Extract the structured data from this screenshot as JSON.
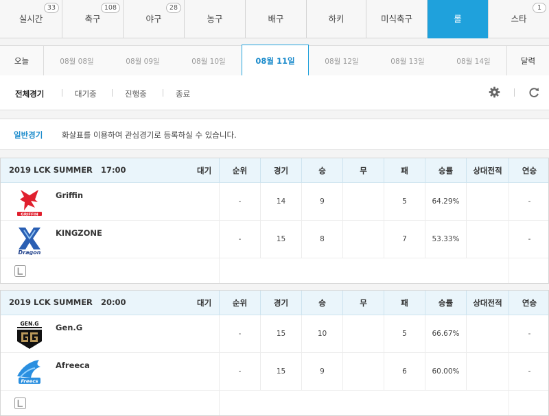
{
  "sport_tabs": [
    {
      "label": "실시간",
      "badge": "33",
      "active": false
    },
    {
      "label": "축구",
      "badge": "108",
      "active": false
    },
    {
      "label": "야구",
      "badge": "28",
      "active": false
    },
    {
      "label": "농구",
      "badge": "",
      "active": false
    },
    {
      "label": "배구",
      "badge": "",
      "active": false
    },
    {
      "label": "하키",
      "badge": "",
      "active": false
    },
    {
      "label": "미식축구",
      "badge": "",
      "active": false
    },
    {
      "label": "롤",
      "badge": "",
      "active": true
    },
    {
      "label": "스타",
      "badge": "1",
      "active": false
    }
  ],
  "date_bar": {
    "today": "오늘",
    "dates": [
      "08월 08일",
      "08월 09일",
      "08월 10일",
      "08월 11일",
      "08월 12일",
      "08월 13일",
      "08월 14일"
    ],
    "active_date": "08월 11일",
    "calendar": "달력"
  },
  "filters": [
    "전체경기",
    "대기중",
    "진행중",
    "종료"
  ],
  "active_filter": "전체경기",
  "notice": {
    "title": "일반경기",
    "text": "화살표를 이용하여 관심경기로 등록하실 수 있습니다."
  },
  "columns": [
    "순위",
    "경기",
    "승",
    "무",
    "패",
    "승률",
    "상대전적",
    "연승"
  ],
  "matches": [
    {
      "league": "2019 LCK SUMMER",
      "time": "17:00",
      "status": "대기",
      "teams": [
        {
          "name": "Griffin",
          "logo": "griffin-logo",
          "rank": "-",
          "games": "14",
          "wins": "9",
          "draws": "",
          "losses": "5",
          "win_rate": "64.29%",
          "h2h": "",
          "streak": "-"
        },
        {
          "name": "KINGZONE",
          "logo": "kingzone-logo",
          "rank": "-",
          "games": "15",
          "wins": "8",
          "draws": "",
          "losses": "7",
          "win_rate": "53.33%",
          "h2h": "",
          "streak": "-"
        }
      ]
    },
    {
      "league": "2019 LCK SUMMER",
      "time": "20:00",
      "status": "대기",
      "teams": [
        {
          "name": "Gen.G",
          "logo": "geng-logo",
          "rank": "-",
          "games": "15",
          "wins": "10",
          "draws": "",
          "losses": "5",
          "win_rate": "66.67%",
          "h2h": "",
          "streak": "-"
        },
        {
          "name": "Afreeca",
          "logo": "afreeca-logo",
          "rank": "-",
          "games": "15",
          "wins": "9",
          "draws": "",
          "losses": "6",
          "win_rate": "60.00%",
          "h2h": "",
          "streak": "-"
        }
      ]
    }
  ],
  "colors": {
    "accent": "#1fa1dc",
    "header_bg": "#eaf5fb",
    "link_blue": "#1d8ccc"
  },
  "icons": {
    "settings": "gear-icon",
    "refresh": "refresh-icon",
    "league": "lol-icon"
  }
}
